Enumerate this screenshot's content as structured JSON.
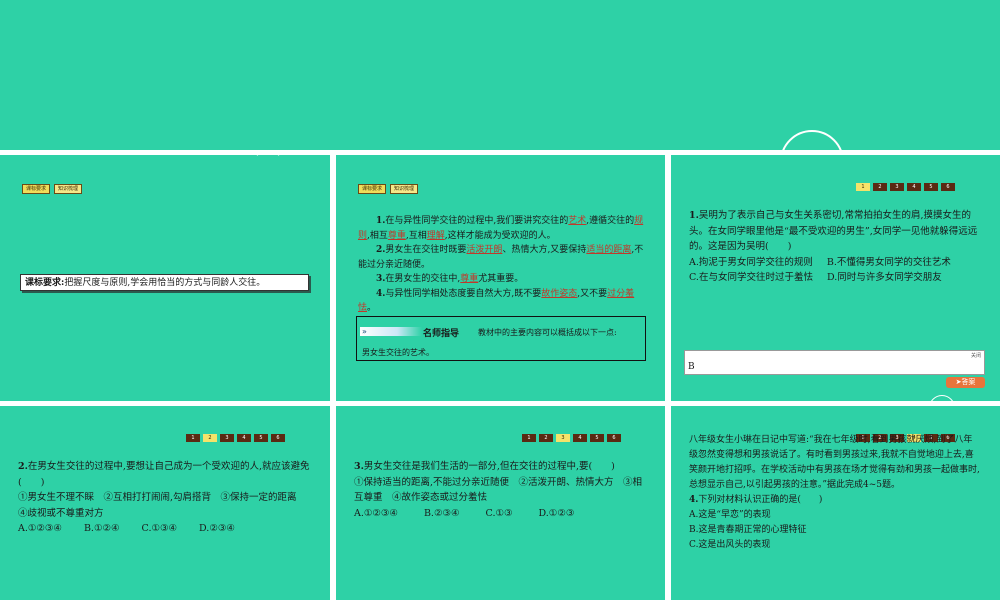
{
  "slide1": {
    "tags": [
      "课标要求",
      "知识梳理"
    ],
    "req_label": "课标要求:",
    "req_text": "把握尺度与原则,学会用恰当的方式与同龄人交往。"
  },
  "slide2": {
    "tags": [
      "课标要求",
      "知识梳理"
    ],
    "p1": [
      "1.",
      "在与异性同学交往的过程中,我们要讲究交往的",
      "艺术",
      ",遵循交往的",
      "规则",
      ",相互",
      "尊重",
      ",互相",
      "理解",
      ",这样才能成为受欢迎的人。"
    ],
    "p2": [
      "2.",
      "男女生在交往时既要",
      "活泼开朗",
      "、热情大方,又要保持",
      "适当的距离",
      ",不能过分亲近随便。"
    ],
    "p3": [
      "3.",
      "在男女生的交往中,",
      "尊重",
      "尤其重要。"
    ],
    "p4": [
      "4.",
      "与异性同学相处态度要自然大方,既不要",
      "故作姿态",
      ",又不要",
      "过分羞怯",
      "。"
    ],
    "guide_arrow": "»",
    "guide_title": "名师指导",
    "guide_desc": "教材中的主要内容可以概括成以下一点:",
    "guide_body": "男女生交往的艺术。"
  },
  "pager": [
    "1",
    "2",
    "3",
    "4",
    "5",
    "6"
  ],
  "slide3": {
    "active_page": 0,
    "num": "1.",
    "stem": "吴明为了表示自己与女生关系密切,常常拍拍女生的肩,摸摸女生的头。在女同学眼里他是“最不受欢迎的男生”,女同学一见他就躲得远远的。这是因为吴明(　　)",
    "opt_a": "A.拘泥于男女同学交往的规则",
    "opt_b": "B.不懂得男女同学的交往艺术",
    "opt_c": "C.在与女同学交往时过于羞怯",
    "opt_d": "D.同时与许多女同学交朋友",
    "close_label": "关闭",
    "answer": "B",
    "answer_button": "答案"
  },
  "slide4": {
    "active_page": 1,
    "num": "2.",
    "stem": "在男女生交往的过程中,要想让自己成为一个受欢迎的人,就应该避免(　　)",
    "items": "①男女生不理不睬　②互相打打闹闹,勾肩搭背　③保持一定的距离",
    "item4": "④歧视或不尊重对方",
    "opts": [
      "A.①②③④",
      "B.①②④",
      "C.①③④",
      "D.②③④"
    ]
  },
  "slide5": {
    "active_page": 2,
    "num": "3.",
    "stem": "男女生交往是我们生活的一部分,但在交往的过程中,要(　　)",
    "items": "①保持适当的距离,不能过分亲近随便　②活泼开朗、热情大方　③相互尊重　④故作姿态或过分羞怯",
    "opts": [
      "A.①②③④",
      "B.②③④",
      "C.①③",
      "D.①②③"
    ]
  },
  "slide6": {
    "active_page": 3,
    "material": "八年级女生小琳在日记中写道:“我在七年级时,看到男孩就厌烦,到了八年级忽然变得想和男孩说话了。有时看到男孩过来,我就不自觉地迎上去,喜笑颜开地打招呼。在学校活动中有男孩在场才觉得有劲和男孩一起做事时,总想显示自己,以引起男孩的注意。”据此完成4~5题。",
    "num": "4.",
    "stem": "下列对材料认识正确的是(　　)",
    "opt_a": "A.这是“早恋”的表现",
    "opt_b": "B.这是青春期正常的心理特征",
    "opt_c": "C.这是出风头的表现"
  }
}
